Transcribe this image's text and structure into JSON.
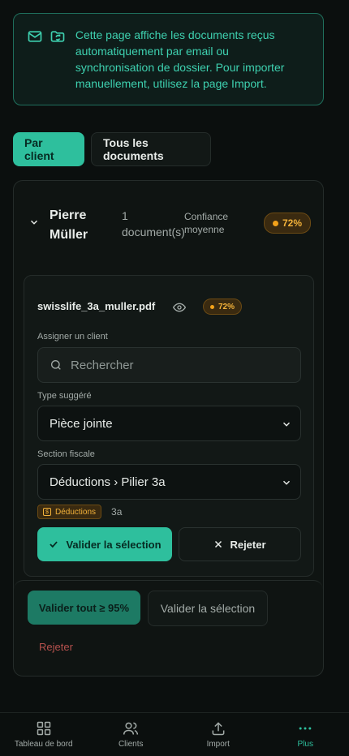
{
  "banner": {
    "text": "Cette page affiche les documents reçus automatiquement par email ou synchronisation de dossier. Pour importer manuellement, utilisez la page Import."
  },
  "tabs": [
    {
      "label": "Par client",
      "active": true
    },
    {
      "label": "Tous les documents",
      "active": false
    }
  ],
  "client": {
    "name": "Pierre Müller",
    "doc_count": "1 document(s)",
    "confidence_label": "Confiance moyenne",
    "confidence": "72%"
  },
  "document": {
    "filename": "swisslife_3a_muller.pdf",
    "confidence": "72%",
    "assign_label": "Assigner un client",
    "search_placeholder": "Rechercher",
    "type_label": "Type suggéré",
    "type_value": "Pièce jointe",
    "section_label": "Section fiscale",
    "section_value": "Déductions › Pilier 3a",
    "tag": "Déductions",
    "tag_sub": "3a",
    "validate_label": "Valider la sélection",
    "reject_label": "Rejeter"
  },
  "bulk": {
    "validate_all": "Valider tout ≥ 95%",
    "validate_selection": "Valider la sélection",
    "reject": "Rejeter"
  },
  "nav": [
    {
      "label": "Tableau de bord",
      "icon": "dashboard-icon"
    },
    {
      "label": "Clients",
      "icon": "users-icon"
    },
    {
      "label": "Import",
      "icon": "upload-icon"
    },
    {
      "label": "Plus",
      "icon": "more-icon",
      "active": true
    }
  ],
  "colors": {
    "accent": "#2ebf9d",
    "warning": "#f3b23a",
    "danger": "#b5514d",
    "background": "#0b0f0e"
  }
}
